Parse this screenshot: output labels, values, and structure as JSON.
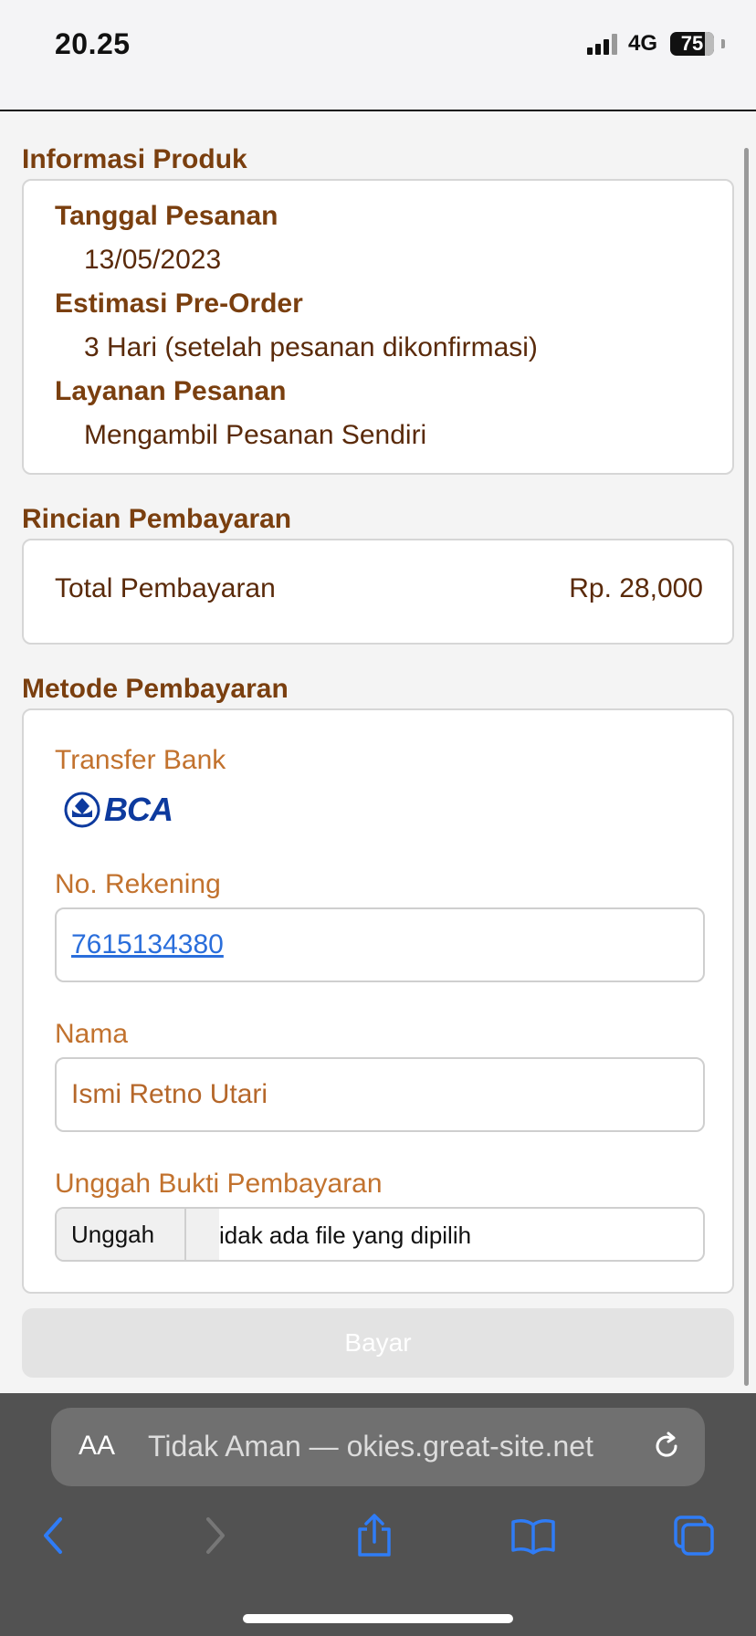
{
  "status": {
    "time": "20.25",
    "network": "4G",
    "battery": "75"
  },
  "product": {
    "title": "Informasi Produk",
    "order_date_label": "Tanggal Pesanan",
    "order_date": "13/05/2023",
    "preorder_label": "Estimasi Pre-Order",
    "preorder_value": "3 Hari (setelah pesanan dikonfirmasi)",
    "service_label": "Layanan Pesanan",
    "service_value": "Mengambil Pesanan Sendiri"
  },
  "payment_details": {
    "title": "Rincian Pembayaran",
    "total_label": "Total Pembayaran",
    "total_value": "Rp. 28,000"
  },
  "payment_method": {
    "title": "Metode Pembayaran",
    "transfer_label": "Transfer Bank",
    "bank_logo_text": "BCA",
    "account_label": "No. Rekening",
    "account_number": "7615134380",
    "name_label": "Nama",
    "name_value": "Ismi Retno Utari",
    "upload_label": "Unggah Bukti Pembayaran",
    "upload_button": "Unggah",
    "upload_status": "idak ada file yang dipilih"
  },
  "pay_button": "Bayar",
  "browser": {
    "aa_label": "AA",
    "url": "Tidak Aman — okies.great-site.net",
    "accent": "#2f7cf6",
    "icons": [
      "back-icon",
      "forward-icon",
      "share-icon",
      "bookmarks-icon",
      "tabs-icon",
      "reload-icon"
    ]
  },
  "colors": {
    "heading": "#7a3f0f",
    "label": "#c2722e",
    "link": "#2a6edb"
  }
}
